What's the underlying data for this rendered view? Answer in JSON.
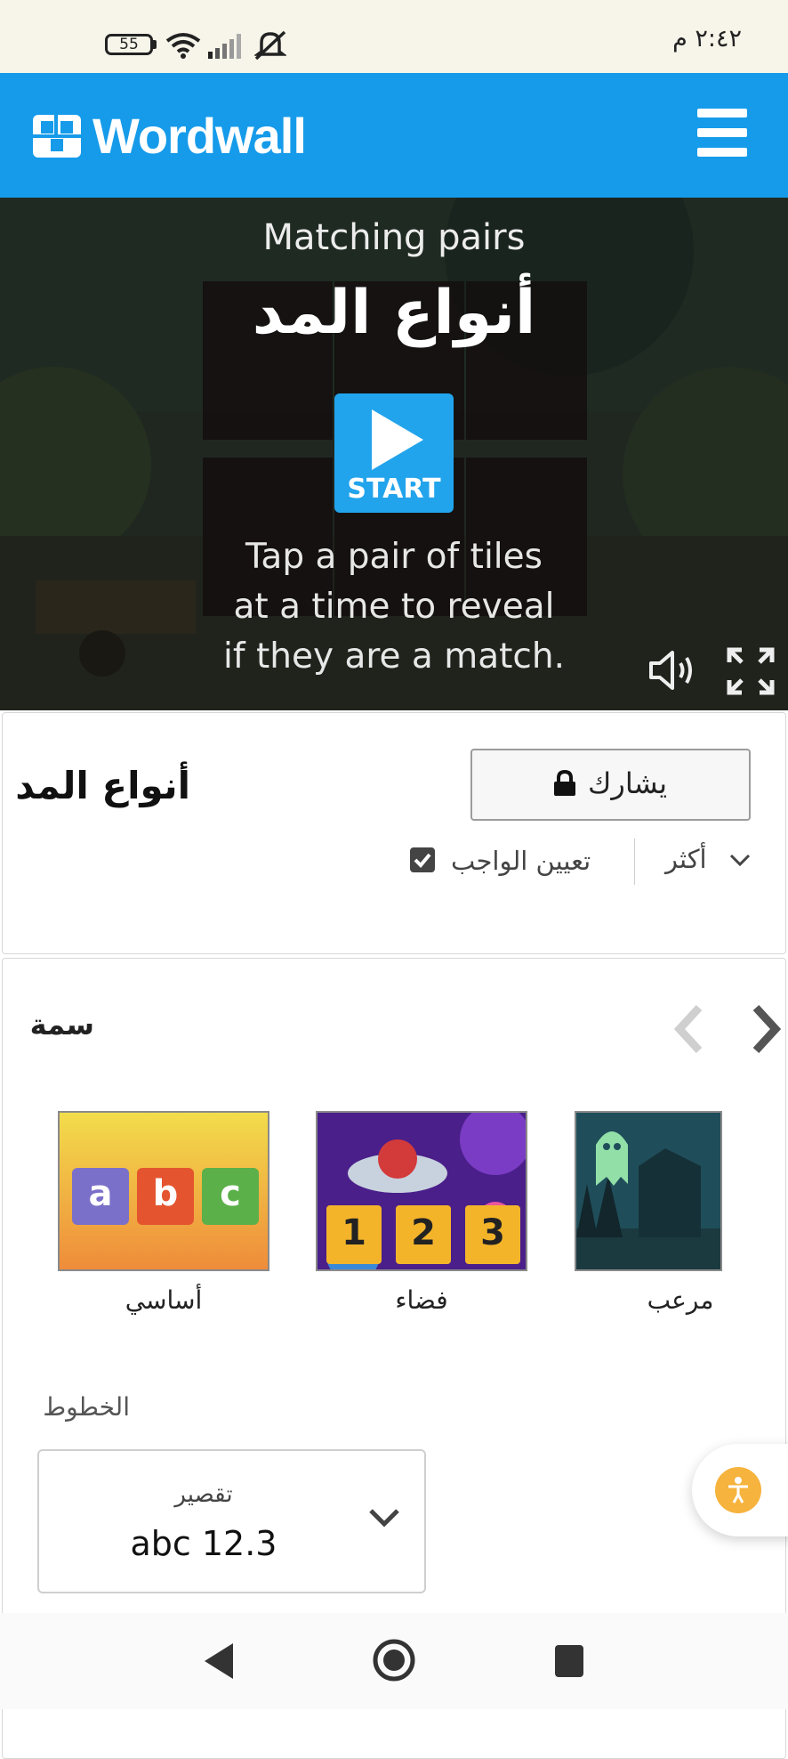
{
  "status_bar": {
    "time": "٢:٤٢ م",
    "battery_level": "55"
  },
  "header": {
    "brand": "Wordwall"
  },
  "game": {
    "template_name": "Matching pairs",
    "activity_title": "أنواع المد",
    "start_label": "START",
    "instructions": [
      "Tap a pair of tiles",
      "at a time to reveal",
      "if they are a match."
    ]
  },
  "activity": {
    "title": "أنواع المد",
    "share_label": "يشارك",
    "assign_label": "تعيين الواجب",
    "assign_checked": true,
    "more_label": "أكثر"
  },
  "theme_section": {
    "title": "سمة",
    "themes": [
      {
        "label": "أساسي",
        "sample_letters": [
          "a",
          "b",
          "c"
        ]
      },
      {
        "label": "فضاء",
        "sample_numbers": [
          "1",
          "2",
          "3"
        ]
      },
      {
        "label": "مرعب"
      }
    ]
  },
  "fonts_section": {
    "title": "الخطوط",
    "selected_font_name": "تقصير",
    "selected_font_sample": "abc 12.3"
  },
  "colors": {
    "brand_blue": "#169bea",
    "start_blue": "#22a4ec",
    "accessibility_orange": "#f6b33d"
  }
}
